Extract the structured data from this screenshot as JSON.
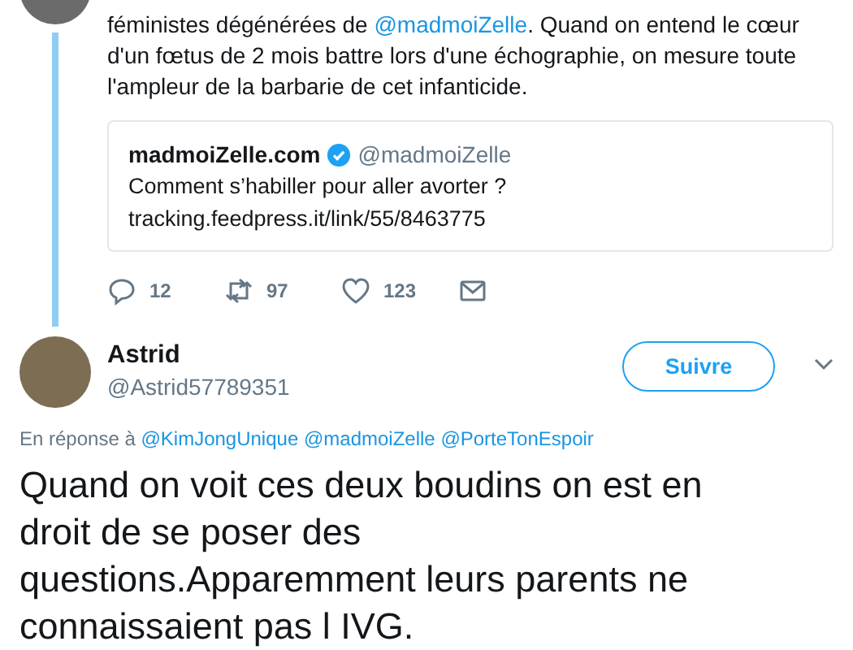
{
  "parent_tweet": {
    "body": [
      {
        "kind": "text",
        "text": "féministes dégénérées de "
      },
      {
        "kind": "mention",
        "text": "@madmoiZelle"
      },
      {
        "kind": "text",
        "text": ". Quand on entend le cœur d'un fœtus de 2 mois battre lors d'une échographie, on mesure toute l'ampleur de la barbarie de cet infanticide."
      }
    ],
    "quote": {
      "name": "madmoiZelle.com",
      "verified": true,
      "handle": "@madmoiZelle",
      "text": "Comment s’habiller pour aller avorter ?",
      "link": "tracking.feedpress.it/link/55/8463775"
    },
    "actions": [
      {
        "kind": "reply",
        "count": "12"
      },
      {
        "kind": "retweet",
        "count": "97"
      },
      {
        "kind": "like",
        "count": "123"
      },
      {
        "kind": "message"
      }
    ]
  },
  "tweet": {
    "name": "Astrid",
    "handle": "@Astrid57789351",
    "follow_button": "Suivre",
    "reply_to": {
      "prefix": "En réponse à",
      "mentions": [
        "@KimJongUnique",
        "@madmoiZelle",
        "@PorteTonEspoir"
      ]
    },
    "text": "Quand on voit ces deux boudins on est en droit de se poser des questions.Apparemment leurs parents ne connaissaient pas l IVG."
  }
}
